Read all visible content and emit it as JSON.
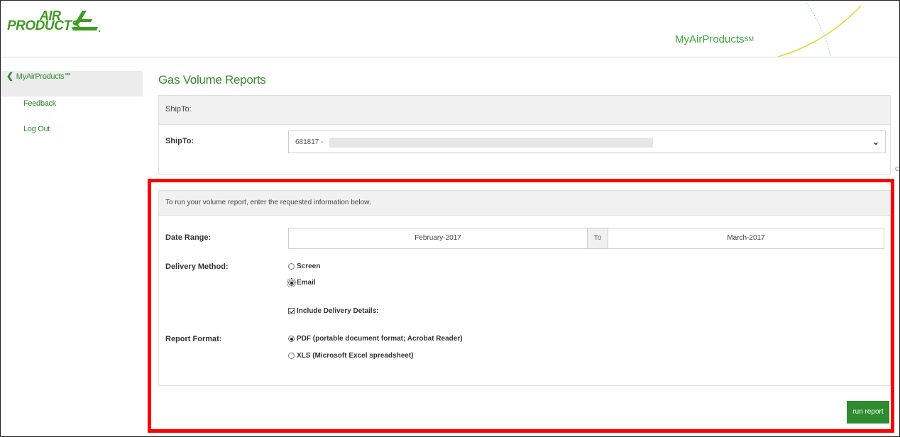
{
  "header": {
    "logo_line1": "AIR",
    "logo_line2": "PRODUCTS",
    "brand": "MyAirProducts",
    "brand_mark": "SM",
    "brand_color": "#3ba437"
  },
  "sidebar": {
    "items": [
      {
        "label": "MyAirProducts℠",
        "icon": "chevron-left-icon"
      },
      {
        "label": "Feedback"
      },
      {
        "label": "Log Out"
      }
    ]
  },
  "page": {
    "title": "Gas Volume Reports"
  },
  "shipto": {
    "section_title": "ShipTo:",
    "label": "ShipTo:",
    "selected_value": "681817 -",
    "dropdown_icon": "chevron-down-icon"
  },
  "form": {
    "instruction": "To run your volume report, enter the requested information below.",
    "date_range_label": "Date Range:",
    "date_from": "February-2017",
    "date_to_separator": "To",
    "date_to": "March-2017",
    "delivery_label": "Delivery Method:",
    "delivery_options": [
      {
        "label": "Screen",
        "selected": false
      },
      {
        "label": "Email",
        "selected": true
      }
    ],
    "include_details_label": "Include Delivery Details:",
    "include_details_checked": true,
    "format_label": "Report Format:",
    "format_options": [
      {
        "label": "PDF (portable document format; Acrobat Reader)",
        "selected": true
      },
      {
        "label": "XLS (Microsoft Excel spreadsheet)",
        "selected": false
      }
    ],
    "run_button": "run report"
  },
  "colors": {
    "accent_green": "#2e8b2e",
    "highlight_red": "#ff0000"
  }
}
